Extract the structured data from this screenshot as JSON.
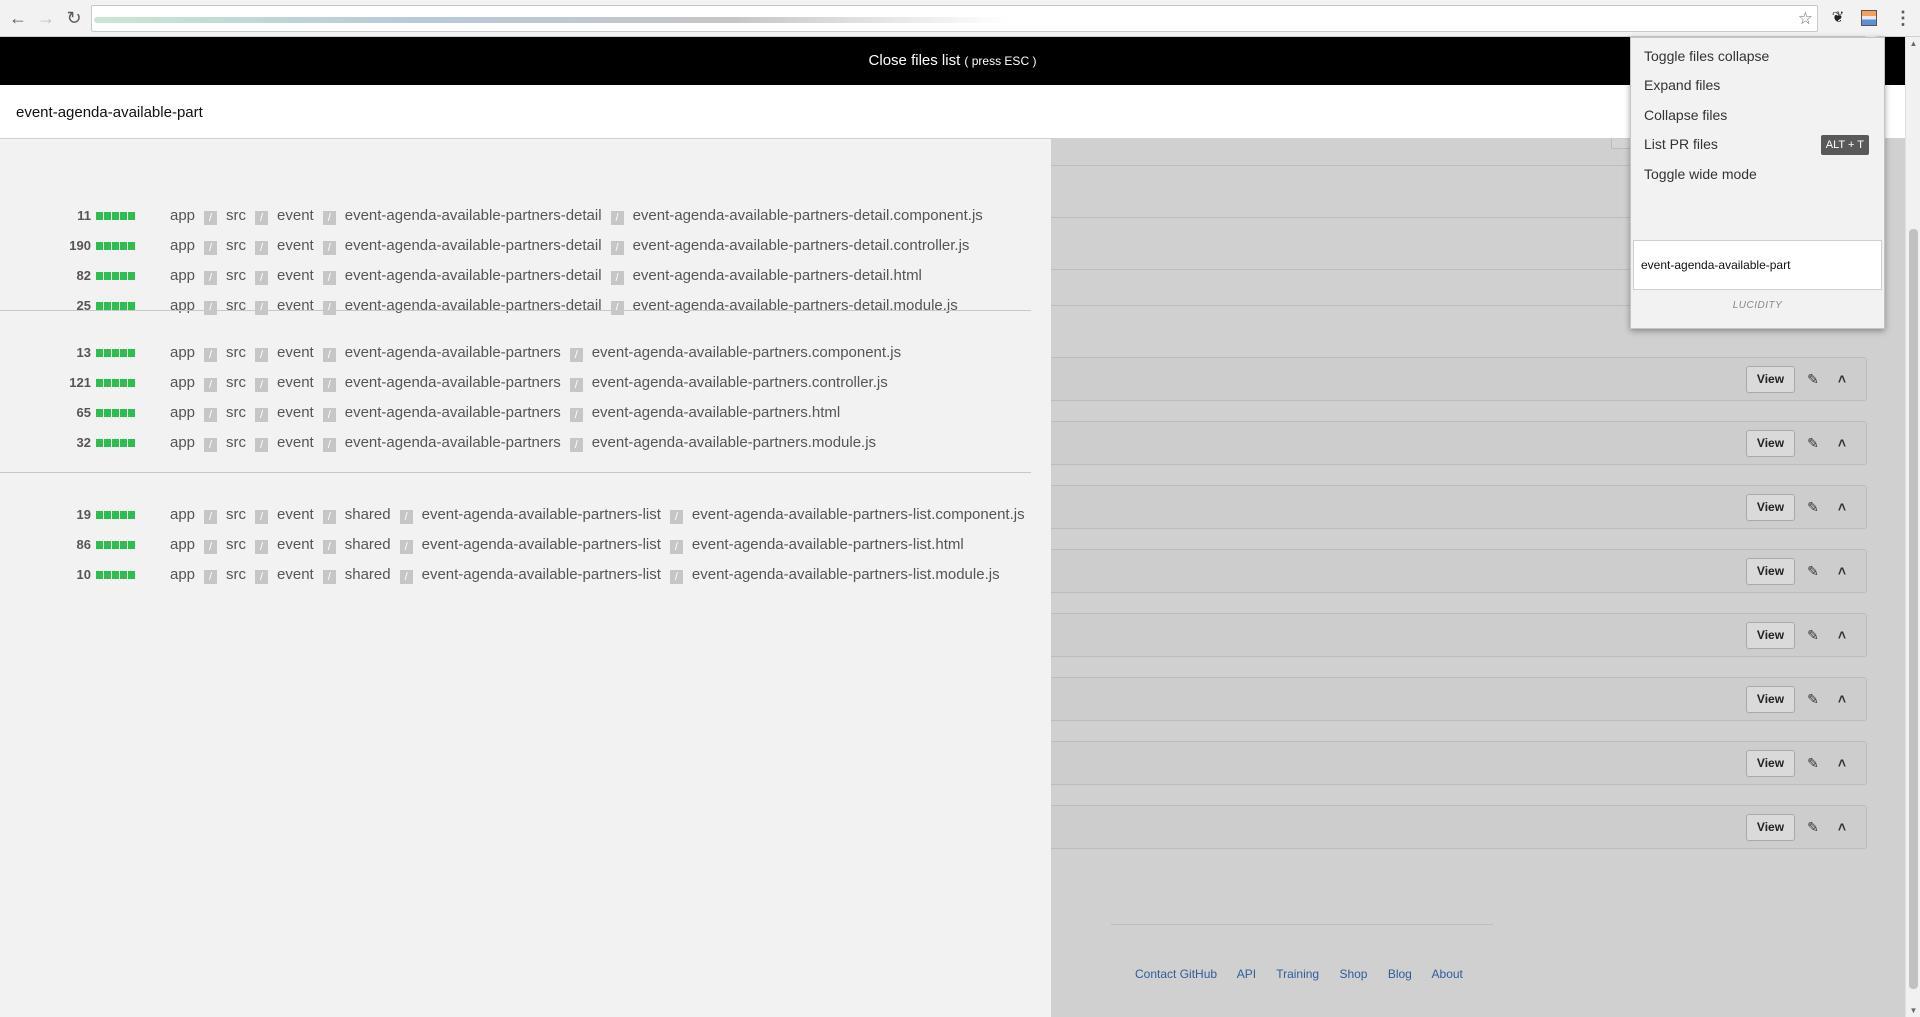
{
  "close_bar": {
    "text": "Close files list",
    "hint": "( press ESC )"
  },
  "file_search": {
    "value": "event-agenda-available-part"
  },
  "file_groups": [
    {
      "files": [
        {
          "count": "11",
          "path": [
            "app",
            "src",
            "event",
            "event-agenda-available-partners-detail",
            "event-agenda-available-partners-detail.component.js"
          ]
        },
        {
          "count": "190",
          "path": [
            "app",
            "src",
            "event",
            "event-agenda-available-partners-detail",
            "event-agenda-available-partners-detail.controller.js"
          ]
        },
        {
          "count": "82",
          "path": [
            "app",
            "src",
            "event",
            "event-agenda-available-partners-detail",
            "event-agenda-available-partners-detail.html"
          ]
        },
        {
          "count": "25",
          "path": [
            "app",
            "src",
            "event",
            "event-agenda-available-partners-detail",
            "event-agenda-available-partners-detail.module.js"
          ]
        }
      ]
    },
    {
      "files": [
        {
          "count": "13",
          "path": [
            "app",
            "src",
            "event",
            "event-agenda-available-partners",
            "event-agenda-available-partners.component.js"
          ]
        },
        {
          "count": "121",
          "path": [
            "app",
            "src",
            "event",
            "event-agenda-available-partners",
            "event-agenda-available-partners.controller.js"
          ]
        },
        {
          "count": "65",
          "path": [
            "app",
            "src",
            "event",
            "event-agenda-available-partners",
            "event-agenda-available-partners.html"
          ]
        },
        {
          "count": "32",
          "path": [
            "app",
            "src",
            "event",
            "event-agenda-available-partners",
            "event-agenda-available-partners.module.js"
          ]
        }
      ]
    },
    {
      "files": [
        {
          "count": "19",
          "path": [
            "app",
            "src",
            "event",
            "shared",
            "event-agenda-available-partners-list",
            "event-agenda-available-partners-list.component.js"
          ]
        },
        {
          "count": "86",
          "path": [
            "app",
            "src",
            "event",
            "shared",
            "event-agenda-available-partners-list",
            "event-agenda-available-partners-list.html"
          ]
        },
        {
          "count": "10",
          "path": [
            "app",
            "src",
            "event",
            "shared",
            "event-agenda-available-partners-list",
            "event-agenda-available-partners-list.module.js"
          ]
        }
      ]
    }
  ],
  "path_separator": "/",
  "diff_bar_blocks": 5,
  "diff_color": "#2cbe4e",
  "file_card": {
    "view_label": "View",
    "count": 8
  },
  "footer": {
    "links": [
      "Contact GitHub",
      "API",
      "Training",
      "Shop",
      "Blog",
      "About"
    ]
  },
  "popup": {
    "items": [
      "Toggle files collapse",
      "Expand files",
      "Collapse files",
      "List PR files",
      "Toggle wide mode"
    ],
    "shortcut": "ALT + T",
    "input_value": "event-agenda-available-part",
    "brand": "LUCIDITY"
  },
  "icons": {
    "back": "arrow-left-icon",
    "forward": "arrow-right-icon",
    "reload": "reload-icon",
    "bookmark": "star-icon",
    "extension_1": "octotree-icon",
    "extension_2": "lucidity-icon",
    "menu": "kebab-menu-icon",
    "edit": "pencil-icon",
    "collapse": "chevron-up-icon"
  }
}
